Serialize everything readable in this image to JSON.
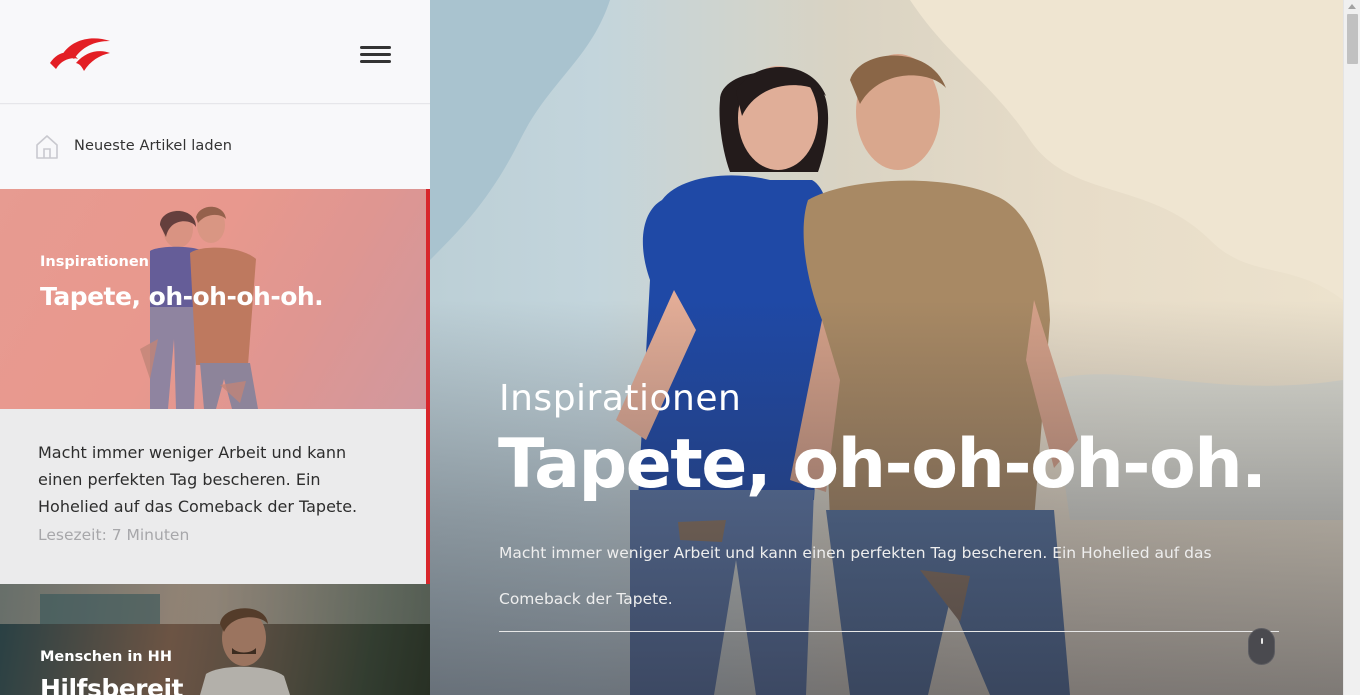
{
  "header": {
    "logo_icon": "bird-wings-logo",
    "menu_icon": "hamburger-menu-icon",
    "brand_color": "#e31e24"
  },
  "sidebar": {
    "latest": {
      "label": "Neueste Artikel laden",
      "icon": "home-icon"
    },
    "active_accent": "#d8262b",
    "articles": [
      {
        "category": "Inspirationen",
        "title": "Tapete, oh-oh-oh-oh.",
        "description": "Macht immer weniger Arbeit und kann einen perfekten Tag bescheren. Ein Hohelied auf das Comeback der Tapete.",
        "reading_time": "Lesezeit: 7 Minuten"
      },
      {
        "category": "Menschen in HH",
        "title": "Hilfsbereit"
      }
    ]
  },
  "hero": {
    "category": "Inspirationen",
    "title": "Tapete, oh-oh-oh-oh.",
    "description": "Macht immer weniger Arbeit und kann einen perfekten Tag bescheren. Ein Hohelied auf das Comeback der Tapete.",
    "scroll_icon": "scroll-down-mouse-icon"
  }
}
